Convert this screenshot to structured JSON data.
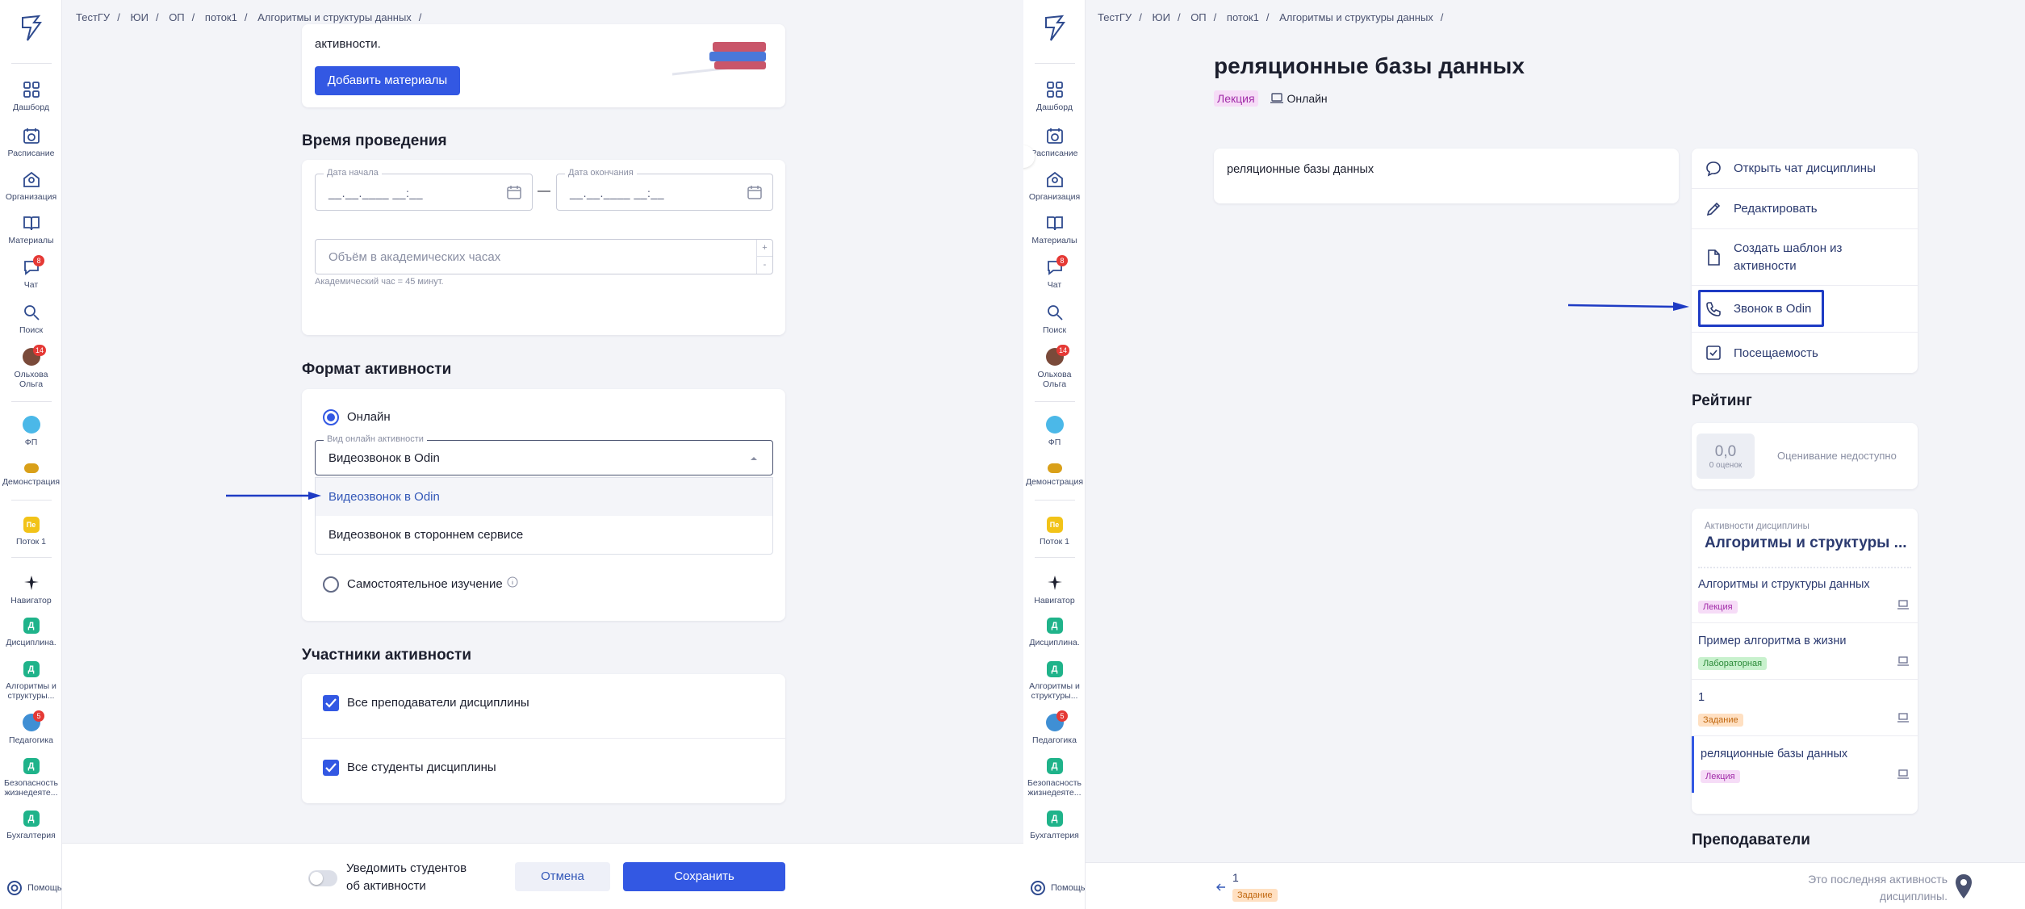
{
  "breadcrumb": [
    "ТестГУ",
    "ЮИ",
    "ОП",
    "поток1",
    "Алгоритмы и структуры данных"
  ],
  "sidebar": {
    "items": [
      {
        "label": "Дашборд",
        "icon": "dashboard-icon"
      },
      {
        "label": "Расписание",
        "icon": "calendar-icon"
      },
      {
        "label": "Организация",
        "icon": "building-icon"
      },
      {
        "label": "Материалы",
        "icon": "book-icon"
      },
      {
        "label": "Чат",
        "icon": "chat-icon",
        "badge": "8"
      },
      {
        "label": "Поиск",
        "icon": "search-icon"
      },
      {
        "label": "Ольхова Ольга",
        "icon": "avatar",
        "badge": "14"
      },
      {
        "label": "ФП",
        "icon": "chat-group-icon"
      },
      {
        "label": "Демонстрация",
        "icon": "demo-icon"
      },
      {
        "label": "Поток 1",
        "icon": "stream-icon",
        "letter": "Пе"
      },
      {
        "label": "Навигатор",
        "icon": "navigator-icon"
      },
      {
        "label": "Дисциплина.",
        "letter": "Д"
      },
      {
        "label": "Алгоритмы и структуры...",
        "letter": "Д"
      },
      {
        "label": "Педагогика",
        "icon": "pedagogy-icon",
        "badge": "5"
      },
      {
        "label": "Безопасность жизнедеяте...",
        "letter": "Д"
      },
      {
        "label": "Бухгалтерия",
        "letter": "Д"
      }
    ],
    "help": "Помощь"
  },
  "left": {
    "intro_text": "активности.",
    "add_materials": "Добавить материалы",
    "time_section": {
      "title": "Время проведения",
      "start_label": "Дата начала",
      "start_value": "__.__.____ __:__",
      "end_label": "Дата окончания",
      "end_value": "__.__.____ __:__",
      "dash": "—",
      "hours_placeholder": "Объём в академических часах",
      "hours_hint": "Академический час = 45 минут.",
      "plus": "+",
      "minus": "-"
    },
    "format_section": {
      "title": "Формат активности",
      "online_label": "Онлайн",
      "online_type_label": "Вид онлайн активности",
      "online_type_value": "Видеозвонок в Odin",
      "options": [
        "Видеозвонок в Odin",
        "Видеозвонок в стороннем сервисе"
      ],
      "self_study_label": "Самостоятельное изучение"
    },
    "participants_section": {
      "title": "Участники активности",
      "all_teachers": "Все преподаватели дисциплины",
      "all_students": "Все студенты дисциплины"
    },
    "footer": {
      "notify": "Уведомить студентов об активности",
      "cancel": "Отмена",
      "save": "Сохранить"
    }
  },
  "right": {
    "title": "реляционные базы данных",
    "type_tag": "Лекция",
    "format": "Онлайн",
    "description": "реляционные базы данных",
    "menu": [
      {
        "label": "Открыть чат дисциплины",
        "icon": "chat-icon"
      },
      {
        "label": "Редактировать",
        "icon": "pencil-icon"
      },
      {
        "label": "Создать шаблон из активности",
        "icon": "document-icon"
      },
      {
        "label": "Звонок в Odin",
        "icon": "phone-icon"
      },
      {
        "label": "Посещаемость",
        "icon": "checkbox-icon"
      }
    ],
    "rating": {
      "title": "Рейтинг",
      "score": "0,0",
      "count": "0 оценок",
      "status": "Оценивание недоступно"
    },
    "activities": {
      "caption": "Активности дисциплины",
      "discipline": "Алгоритмы и структуры ...",
      "items": [
        {
          "title": "Алгоритмы и структуры данных",
          "tag": "Лекция",
          "kind": "lec"
        },
        {
          "title": "Пример алгоритма в жизни",
          "tag": "Лабораторная",
          "kind": "lab"
        },
        {
          "title": "1",
          "tag": "Задание",
          "kind": "task"
        },
        {
          "title": "реляционные базы данных",
          "tag": "Лекция",
          "kind": "lec"
        }
      ]
    },
    "teachers_title": "Преподаватели",
    "footer": {
      "prev_title": "1",
      "prev_tag": "Задание",
      "last_note": "Это последняя активность дисциплины."
    }
  }
}
